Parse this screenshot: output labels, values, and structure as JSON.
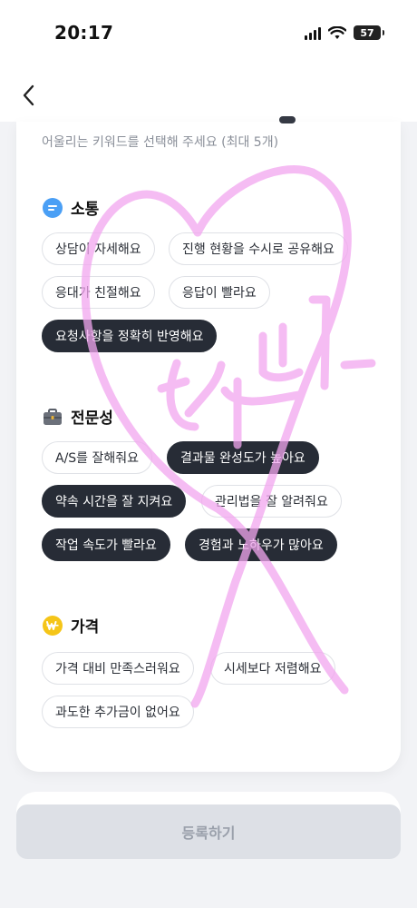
{
  "status_bar": {
    "time": "20:17",
    "battery_level": "57"
  },
  "nav": {
    "back_icon": "chevron-left-icon"
  },
  "instructions": {
    "hint": "어울리는 키워드를 선택해 주세요 (최대 5개)"
  },
  "categories": [
    {
      "title": "소통",
      "icon": "speech-bubble-icon",
      "chips": [
        {
          "label": "상담이 자세해요",
          "selected": false
        },
        {
          "label": "진행 현황을 수시로 공유해요",
          "selected": false
        },
        {
          "label": "응대가 친절해요",
          "selected": false
        },
        {
          "label": "응답이 빨라요",
          "selected": false
        },
        {
          "label": "요청사항을 정확히 반영해요",
          "selected": true
        }
      ]
    },
    {
      "title": "전문성",
      "icon": "briefcase-icon",
      "chips": [
        {
          "label": "A/S를 잘해줘요",
          "selected": false
        },
        {
          "label": "결과물 완성도가 높아요",
          "selected": true
        },
        {
          "label": "약속 시간을 잘 지켜요",
          "selected": true
        },
        {
          "label": "관리법을 잘 알려줘요",
          "selected": false
        },
        {
          "label": "작업 속도가 빨라요",
          "selected": true
        },
        {
          "label": "경험과 노하우가 많아요",
          "selected": true
        }
      ]
    },
    {
      "title": "가격",
      "icon": "won-coin-icon",
      "chips": [
        {
          "label": "가격 대비 만족스러워요",
          "selected": false
        },
        {
          "label": "시세보다 저렴해요",
          "selected": false
        },
        {
          "label": "과도한 추가금이 없어요",
          "selected": false
        }
      ]
    }
  ],
  "footer": {
    "register_label": "등록하기"
  },
  "overlay": {
    "handwritten_text": "전부!",
    "color": "#f2a6ef"
  },
  "colors": {
    "selected_chip": "#272c36",
    "chip_border": "#dfe1e6",
    "disabled_button": "#dde0e6"
  }
}
